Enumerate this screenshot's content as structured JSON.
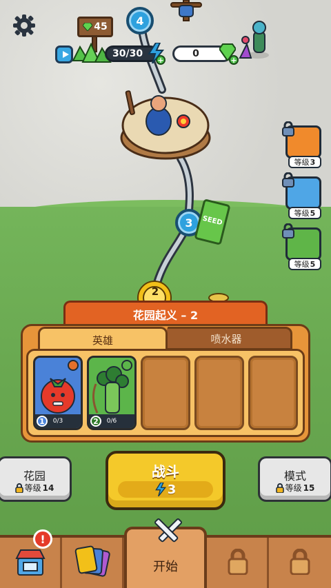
{
  "top": {
    "sign_gems": "45",
    "energy": "30/30",
    "gems": "0"
  },
  "map": {
    "nodes": [
      {
        "number": "4"
      },
      {
        "number": "3"
      },
      {
        "number": "2"
      }
    ],
    "seed_pack_label": "SEED"
  },
  "rewards": [
    {
      "icon": "gift-box-icon",
      "level_label": "等级",
      "level_value": "3"
    },
    {
      "icon": "checklist-icon",
      "level_label": "等级",
      "level_value": "5"
    },
    {
      "icon": "purple-ribbon-gift-icon",
      "level_label": "等级",
      "level_value": "5"
    }
  ],
  "mission": {
    "title": "花园起义 – 2",
    "tabs": [
      "英雄",
      "喷水器"
    ],
    "active_tab": 0,
    "heroes": [
      {
        "name": "tomato",
        "level": "1",
        "progress": "0/3",
        "color": "#4a82d8",
        "role_color": "#e5702b"
      },
      {
        "name": "broccoli",
        "level": "2",
        "progress": "0/6",
        "color": "#5cb54a",
        "role_color": "#5cb54a"
      }
    ],
    "empty_slots": 3
  },
  "controls": {
    "garden": {
      "title": "花园",
      "level_label": "等级",
      "level_value": "14"
    },
    "battle": {
      "title": "战斗",
      "cost": "3"
    },
    "mode": {
      "title": "模式",
      "level_label": "等级",
      "level_value": "15"
    }
  },
  "navbar": {
    "shop_badge": "!",
    "start_label": "开始"
  },
  "colors": {
    "accent_orange": "#e26323",
    "panel": "#e7953a",
    "battle_yellow": "#f4c92a",
    "node_blue": "#2ea1de",
    "grass": "#6aa951"
  }
}
